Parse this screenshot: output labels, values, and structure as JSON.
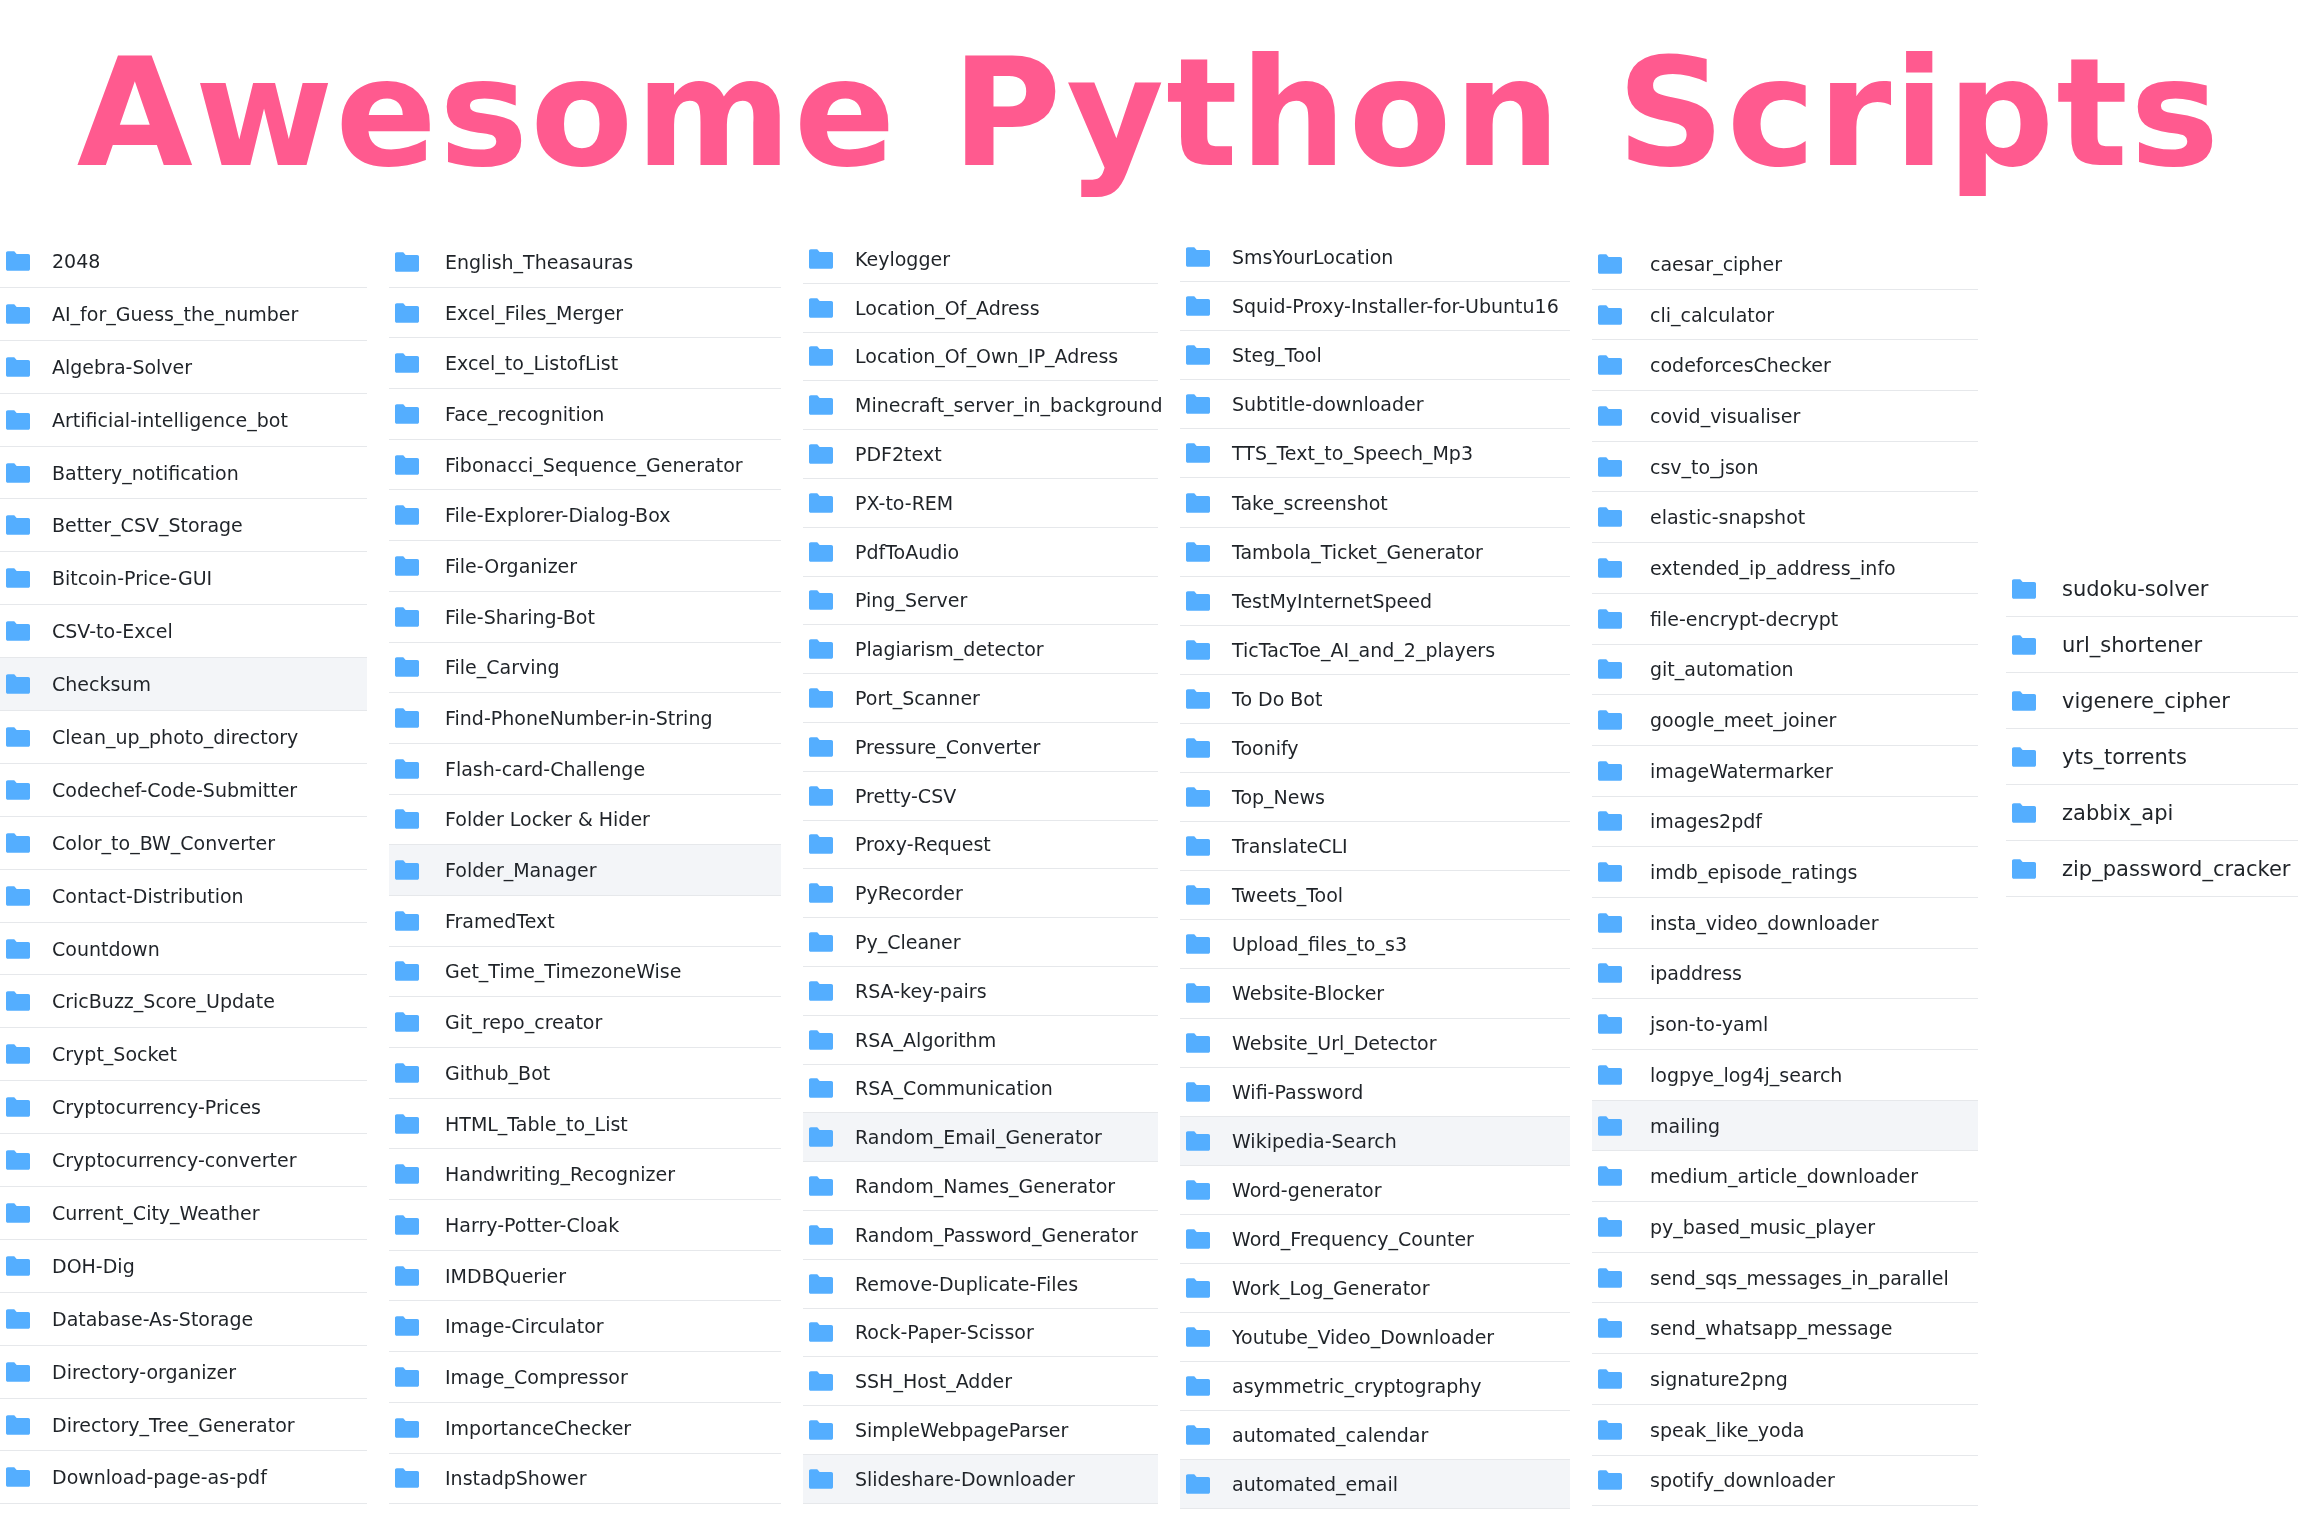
{
  "title": "Awesome Python Scripts",
  "columns": [
    {
      "items": [
        {
          "name": "2048",
          "highlighted": false
        },
        {
          "name": "AI_for_Guess_the_number",
          "highlighted": false
        },
        {
          "name": "Algebra-Solver",
          "highlighted": false
        },
        {
          "name": "Artificial-intelligence_bot",
          "highlighted": false
        },
        {
          "name": "Battery_notification",
          "highlighted": false
        },
        {
          "name": "Better_CSV_Storage",
          "highlighted": false
        },
        {
          "name": "Bitcoin-Price-GUI",
          "highlighted": false
        },
        {
          "name": "CSV-to-Excel",
          "highlighted": false
        },
        {
          "name": "Checksum",
          "highlighted": true
        },
        {
          "name": "Clean_up_photo_directory",
          "highlighted": false
        },
        {
          "name": "Codechef-Code-Submitter",
          "highlighted": false
        },
        {
          "name": "Color_to_BW_Converter",
          "highlighted": false
        },
        {
          "name": "Contact-Distribution",
          "highlighted": false
        },
        {
          "name": "Countdown",
          "highlighted": false
        },
        {
          "name": "CricBuzz_Score_Update",
          "highlighted": false
        },
        {
          "name": "Crypt_Socket",
          "highlighted": false
        },
        {
          "name": "Cryptocurrency-Prices",
          "highlighted": false
        },
        {
          "name": "Cryptocurrency-converter",
          "highlighted": false
        },
        {
          "name": "Current_City_Weather",
          "highlighted": false
        },
        {
          "name": "DOH-Dig",
          "highlighted": false
        },
        {
          "name": "Database-As-Storage",
          "highlighted": false
        },
        {
          "name": "Directory-organizer",
          "highlighted": false
        },
        {
          "name": "Directory_Tree_Generator",
          "highlighted": false
        },
        {
          "name": "Download-page-as-pdf",
          "highlighted": false
        }
      ]
    },
    {
      "items": [
        {
          "name": "English_Theasauras",
          "highlighted": false
        },
        {
          "name": "Excel_Files_Merger",
          "highlighted": false
        },
        {
          "name": "Excel_to_ListofList",
          "highlighted": false
        },
        {
          "name": "Face_recognition",
          "highlighted": false
        },
        {
          "name": "Fibonacci_Sequence_Generator",
          "highlighted": false
        },
        {
          "name": "File-Explorer-Dialog-Box",
          "highlighted": false
        },
        {
          "name": "File-Organizer",
          "highlighted": false
        },
        {
          "name": "File-Sharing-Bot",
          "highlighted": false
        },
        {
          "name": "File_Carving",
          "highlighted": false
        },
        {
          "name": "Find-PhoneNumber-in-String",
          "highlighted": false
        },
        {
          "name": "Flash-card-Challenge",
          "highlighted": false
        },
        {
          "name": "Folder Locker & Hider",
          "highlighted": false
        },
        {
          "name": "Folder_Manager",
          "highlighted": true
        },
        {
          "name": "FramedText",
          "highlighted": false
        },
        {
          "name": "Get_Time_TimezoneWise",
          "highlighted": false
        },
        {
          "name": "Git_repo_creator",
          "highlighted": false
        },
        {
          "name": "Github_Bot",
          "highlighted": false
        },
        {
          "name": "HTML_Table_to_List",
          "highlighted": false
        },
        {
          "name": "Handwriting_Recognizer",
          "highlighted": false
        },
        {
          "name": "Harry-Potter-Cloak",
          "highlighted": false
        },
        {
          "name": "IMDBQuerier",
          "highlighted": false
        },
        {
          "name": "Image-Circulator",
          "highlighted": false
        },
        {
          "name": "Image_Compressor",
          "highlighted": false
        },
        {
          "name": "ImportanceChecker",
          "highlighted": false
        },
        {
          "name": "InstadpShower",
          "highlighted": false
        }
      ]
    },
    {
      "items": [
        {
          "name": "Keylogger",
          "highlighted": false
        },
        {
          "name": "Location_Of_Adress",
          "highlighted": false
        },
        {
          "name": "Location_Of_Own_IP_Adress",
          "highlighted": false
        },
        {
          "name": "Minecraft_server_in_background",
          "highlighted": false
        },
        {
          "name": "PDF2text",
          "highlighted": false
        },
        {
          "name": "PX-to-REM",
          "highlighted": false
        },
        {
          "name": "PdfToAudio",
          "highlighted": false
        },
        {
          "name": "Ping_Server",
          "highlighted": false
        },
        {
          "name": "Plagiarism_detector",
          "highlighted": false
        },
        {
          "name": "Port_Scanner",
          "highlighted": false
        },
        {
          "name": "Pressure_Converter",
          "highlighted": false
        },
        {
          "name": "Pretty-CSV",
          "highlighted": false
        },
        {
          "name": "Proxy-Request",
          "highlighted": false
        },
        {
          "name": "PyRecorder",
          "highlighted": false
        },
        {
          "name": "Py_Cleaner",
          "highlighted": false
        },
        {
          "name": "RSA-key-pairs",
          "highlighted": false
        },
        {
          "name": "RSA_Algorithm",
          "highlighted": false
        },
        {
          "name": "RSA_Communication",
          "highlighted": false
        },
        {
          "name": "Random_Email_Generator",
          "highlighted": true
        },
        {
          "name": "Random_Names_Generator",
          "highlighted": false
        },
        {
          "name": "Random_Password_Generator",
          "highlighted": false
        },
        {
          "name": "Remove-Duplicate-Files",
          "highlighted": false
        },
        {
          "name": "Rock-Paper-Scissor",
          "highlighted": false
        },
        {
          "name": "SSH_Host_Adder",
          "highlighted": false
        },
        {
          "name": "SimpleWebpageParser",
          "highlighted": false
        },
        {
          "name": "Slideshare-Downloader",
          "highlighted": true
        }
      ]
    },
    {
      "items": [
        {
          "name": "SmsYourLocation",
          "highlighted": false
        },
        {
          "name": "Squid-Proxy-Installer-for-Ubuntu16",
          "highlighted": false
        },
        {
          "name": "Steg_Tool",
          "highlighted": false
        },
        {
          "name": "Subtitle-downloader",
          "highlighted": false
        },
        {
          "name": "TTS_Text_to_Speech_Mp3",
          "highlighted": false
        },
        {
          "name": "Take_screenshot",
          "highlighted": false
        },
        {
          "name": "Tambola_Ticket_Generator",
          "highlighted": false
        },
        {
          "name": "TestMyInternetSpeed",
          "highlighted": false
        },
        {
          "name": "TicTacToe_AI_and_2_players",
          "highlighted": false
        },
        {
          "name": "To Do Bot",
          "highlighted": false
        },
        {
          "name": "Toonify",
          "highlighted": false
        },
        {
          "name": "Top_News",
          "highlighted": false
        },
        {
          "name": "TranslateCLI",
          "highlighted": false
        },
        {
          "name": "Tweets_Tool",
          "highlighted": false
        },
        {
          "name": "Upload_files_to_s3",
          "highlighted": false
        },
        {
          "name": "Website-Blocker",
          "highlighted": false
        },
        {
          "name": "Website_Url_Detector",
          "highlighted": false
        },
        {
          "name": "Wifi-Password",
          "highlighted": false
        },
        {
          "name": "Wikipedia-Search",
          "highlighted": true
        },
        {
          "name": "Word-generator",
          "highlighted": false
        },
        {
          "name": "Word_Frequency_Counter",
          "highlighted": false
        },
        {
          "name": "Work_Log_Generator",
          "highlighted": false
        },
        {
          "name": "Youtube_Video_Downloader",
          "highlighted": false
        },
        {
          "name": "asymmetric_cryptography",
          "highlighted": false
        },
        {
          "name": "automated_calendar",
          "highlighted": false
        },
        {
          "name": "automated_email",
          "highlighted": true
        }
      ]
    },
    {
      "items": [
        {
          "name": "caesar_cipher",
          "highlighted": false
        },
        {
          "name": "cli_calculator",
          "highlighted": false
        },
        {
          "name": "codeforcesChecker",
          "highlighted": false
        },
        {
          "name": "covid_visualiser",
          "highlighted": false
        },
        {
          "name": "csv_to_json",
          "highlighted": false
        },
        {
          "name": "elastic-snapshot",
          "highlighted": false
        },
        {
          "name": "extended_ip_address_info",
          "highlighted": false
        },
        {
          "name": "file-encrypt-decrypt",
          "highlighted": false
        },
        {
          "name": "git_automation",
          "highlighted": false
        },
        {
          "name": "google_meet_joiner",
          "highlighted": false
        },
        {
          "name": "imageWatermarker",
          "highlighted": false
        },
        {
          "name": "images2pdf",
          "highlighted": false
        },
        {
          "name": "imdb_episode_ratings",
          "highlighted": false
        },
        {
          "name": "insta_video_downloader",
          "highlighted": false
        },
        {
          "name": "ipaddress",
          "highlighted": false
        },
        {
          "name": "json-to-yaml",
          "highlighted": false
        },
        {
          "name": "logpye_log4j_search",
          "highlighted": false
        },
        {
          "name": "mailing",
          "highlighted": true
        },
        {
          "name": "medium_article_downloader",
          "highlighted": false
        },
        {
          "name": "py_based_music_player",
          "highlighted": false
        },
        {
          "name": "send_sqs_messages_in_parallel",
          "highlighted": false
        },
        {
          "name": "send_whatsapp_message",
          "highlighted": false
        },
        {
          "name": "signature2png",
          "highlighted": false
        },
        {
          "name": "speak_like_yoda",
          "highlighted": false
        },
        {
          "name": "spotify_downloader",
          "highlighted": false
        }
      ]
    },
    {
      "items": [
        {
          "name": "sudoku-solver",
          "highlighted": false
        },
        {
          "name": "url_shortener",
          "highlighted": false
        },
        {
          "name": "vigenere_cipher",
          "highlighted": false
        },
        {
          "name": "yts_torrents",
          "highlighted": false
        },
        {
          "name": "zabbix_api",
          "highlighted": false
        },
        {
          "name": "zip_password_cracker",
          "highlighted": false
        }
      ]
    }
  ]
}
